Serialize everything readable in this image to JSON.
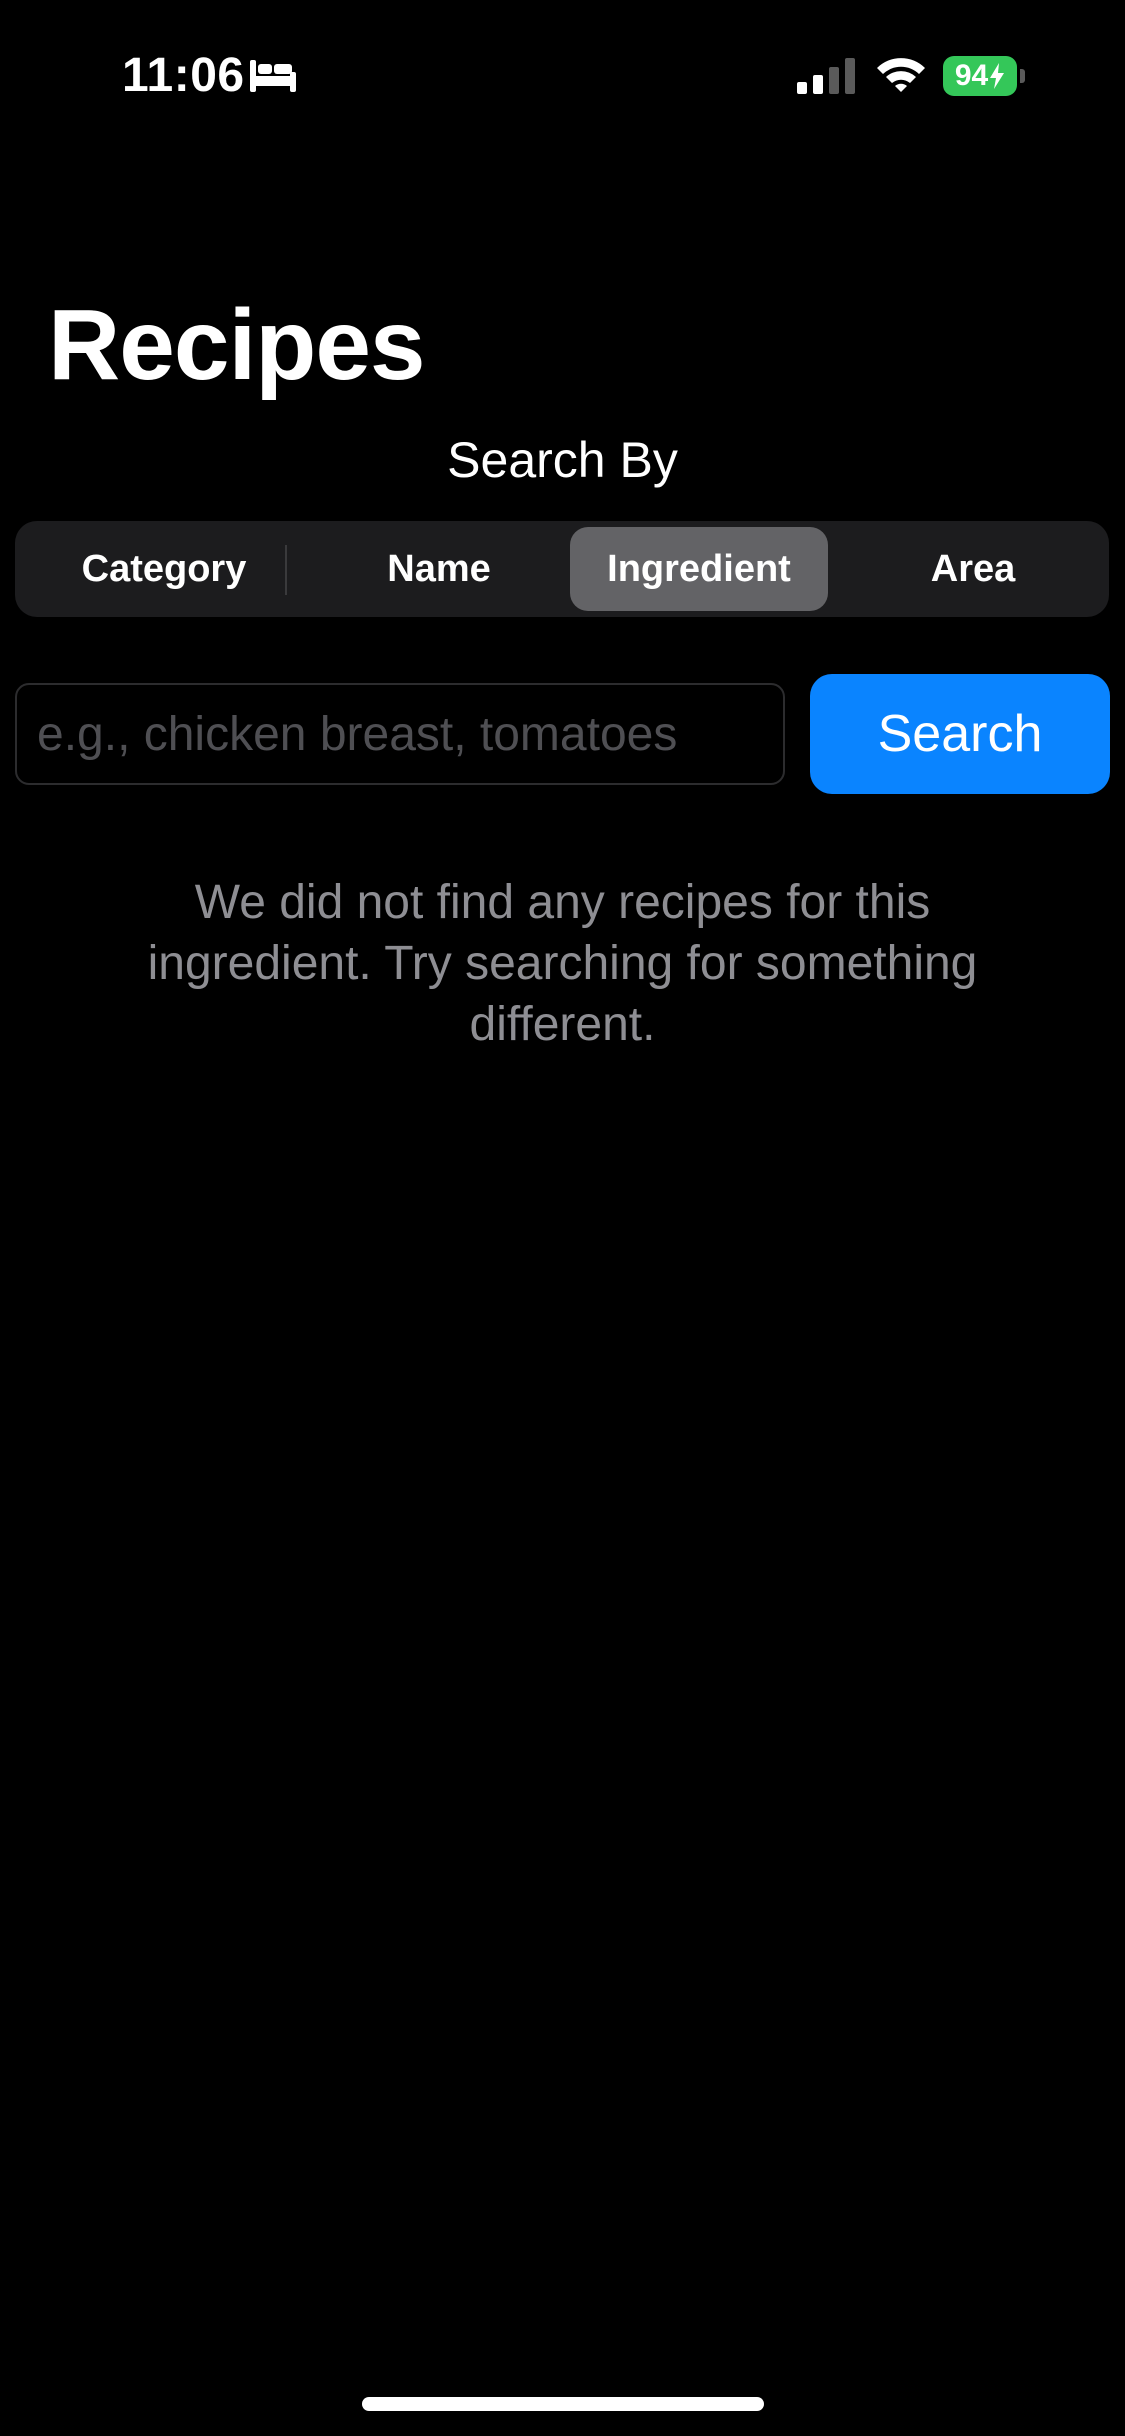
{
  "status_bar": {
    "time": "11:06",
    "battery_level": "94",
    "battery_color": "#34c759",
    "icons": [
      "bed-icon",
      "cellular-signal-icon",
      "wifi-icon",
      "battery-icon",
      "charging-bolt-icon"
    ]
  },
  "header": {
    "title": "Recipes"
  },
  "search_by": {
    "label": "Search By",
    "segments": [
      {
        "label": "Category"
      },
      {
        "label": "Name"
      },
      {
        "label": "Ingredient"
      },
      {
        "label": "Area"
      }
    ],
    "selected": "Ingredient"
  },
  "search": {
    "value": "",
    "placeholder": "e.g., chicken breast, tomatoes",
    "button_label": "Search",
    "button_color": "#0a84ff"
  },
  "empty_state": {
    "message": "We did not find any recipes for this ingredient. Try searching for something different."
  }
}
